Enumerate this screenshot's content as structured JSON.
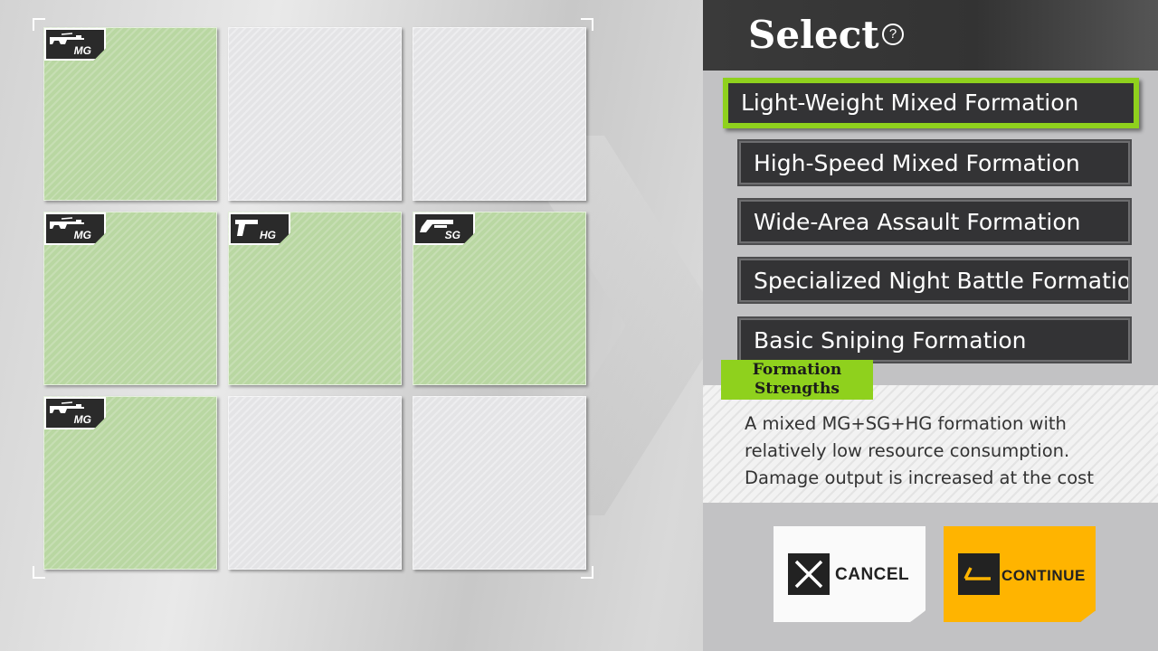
{
  "grid": {
    "cells": [
      {
        "row": 1,
        "col": 1,
        "type": "MG",
        "filled": true
      },
      {
        "row": 1,
        "col": 2,
        "type": "",
        "filled": false
      },
      {
        "row": 1,
        "col": 3,
        "type": "",
        "filled": false
      },
      {
        "row": 2,
        "col": 1,
        "type": "MG",
        "filled": true
      },
      {
        "row": 2,
        "col": 2,
        "type": "HG",
        "filled": true
      },
      {
        "row": 2,
        "col": 3,
        "type": "SG",
        "filled": true
      },
      {
        "row": 3,
        "col": 1,
        "type": "MG",
        "filled": true
      },
      {
        "row": 3,
        "col": 2,
        "type": "",
        "filled": false
      },
      {
        "row": 3,
        "col": 3,
        "type": "",
        "filled": false
      }
    ]
  },
  "panel": {
    "title": "Select",
    "help_icon": "question-circle-icon",
    "options": [
      {
        "label": "Light-Weight Mixed Formation",
        "selected": true
      },
      {
        "label": "High-Speed Mixed Formation",
        "selected": false
      },
      {
        "label": "Wide-Area Assault Formation",
        "selected": false
      },
      {
        "label": "Specialized Night Battle Formation",
        "selected": false
      },
      {
        "label": "Basic Sniping Formation",
        "selected": false
      }
    ],
    "strengths_label": "Formation Strengths",
    "description": "A mixed MG+SG+HG formation with relatively low resource consumption. Damage output is increased at the cost"
  },
  "buttons": {
    "cancel_label": "CANCEL",
    "continue_label": "CONTINUE"
  },
  "colors": {
    "accent_green": "#8fd11d",
    "continue_yellow": "#ffb400",
    "filled_cell": "#b9d7a2",
    "empty_cell": "#e4e4e6"
  }
}
